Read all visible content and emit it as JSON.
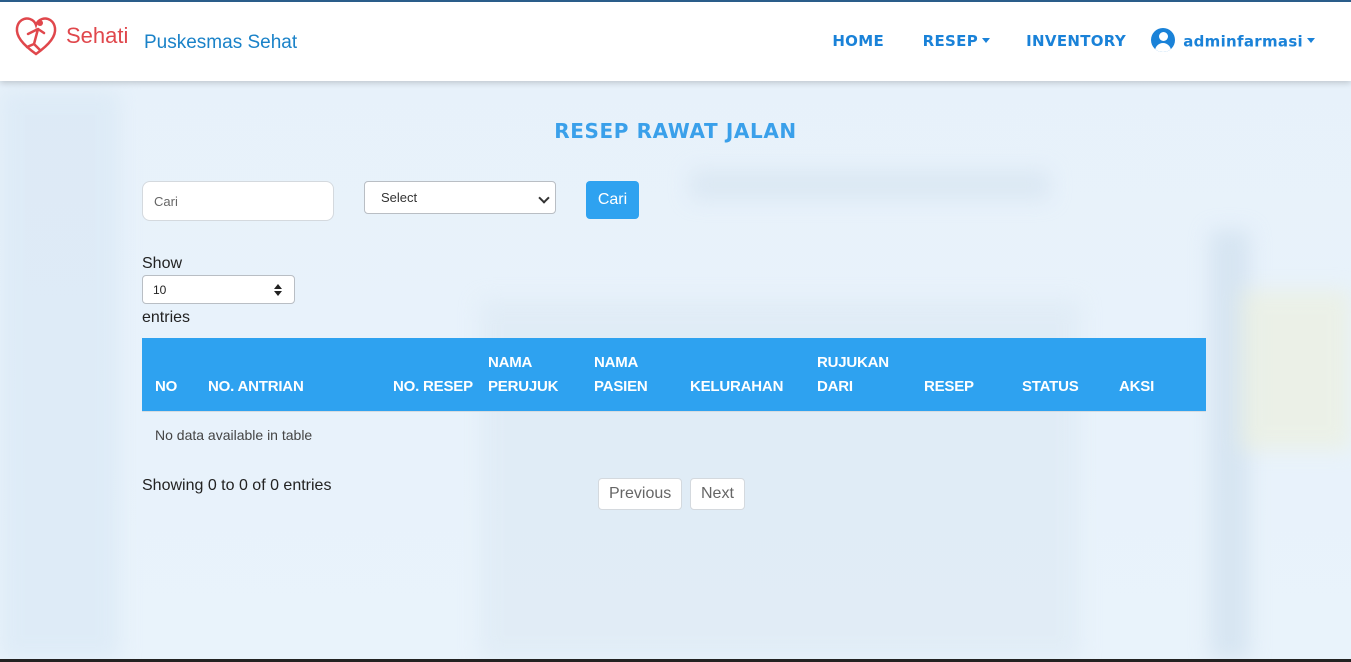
{
  "brand": {
    "name": "Sehati",
    "subtitle": "Puskesmas Sehat"
  },
  "nav": {
    "home": "HOME",
    "resep": "RESEP",
    "inventory": "INVENTORY",
    "user": "adminfarmasi"
  },
  "page": {
    "title": "RESEP RAWAT JALAN"
  },
  "filters": {
    "search_placeholder": "Cari",
    "select_value": "Select",
    "search_button": "Cari"
  },
  "table": {
    "show_label": "Show",
    "length_value": "10",
    "entries_label": "entries",
    "columns": [
      [
        "NO"
      ],
      [
        "NO. ANTRIAN"
      ],
      [
        "NO. RESEP"
      ],
      [
        "NAMA",
        "PERUJUK"
      ],
      [
        "NAMA",
        "PASIEN"
      ],
      [
        "KELURAHAN"
      ],
      [
        "RUJUKAN",
        "DARI"
      ],
      [
        "RESEP"
      ],
      [
        "STATUS"
      ],
      [
        "AKSI"
      ]
    ],
    "empty_message": "No data available in table",
    "info": "Showing 0 to 0 of 0 entries",
    "previous": "Previous",
    "next": "Next"
  },
  "colors": {
    "accent": "#2ea2f0",
    "nav_text": "#1a82d8",
    "brand_red": "#e0474c",
    "title": "#3aa0ea"
  }
}
